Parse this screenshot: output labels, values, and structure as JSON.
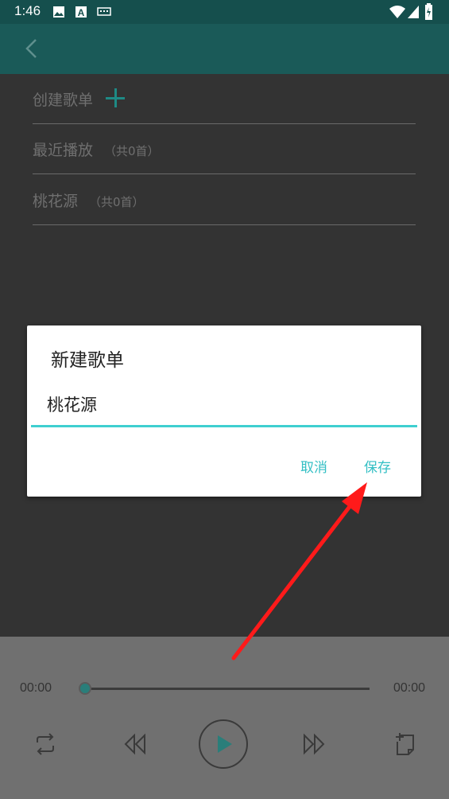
{
  "status_bar": {
    "time": "1:46",
    "icons": [
      "image-icon",
      "a-icon",
      "keyboard-icon",
      "wifi-icon",
      "signal-icon",
      "battery-icon"
    ]
  },
  "app_bar": {
    "back_icon": "chevron-left-icon"
  },
  "playlists": {
    "create_label": "创建歌单",
    "items": [
      {
        "title": "最近播放",
        "count": "（共0首）"
      },
      {
        "title": "桃花源",
        "count": "（共0首）"
      }
    ]
  },
  "dialog": {
    "title": "新建歌单",
    "input_value": "桃花源",
    "cancel_label": "取消",
    "save_label": "保存"
  },
  "player": {
    "elapsed": "00:00",
    "duration": "00:00",
    "progress": 0,
    "controls": [
      "repeat-icon",
      "rewind-icon",
      "play-icon",
      "fast-forward-icon",
      "add-to-playlist-icon"
    ]
  },
  "colors": {
    "accent": "#3fcfd0",
    "appbar": "#1a5a58",
    "annotation_arrow": "#ff1a1a"
  }
}
